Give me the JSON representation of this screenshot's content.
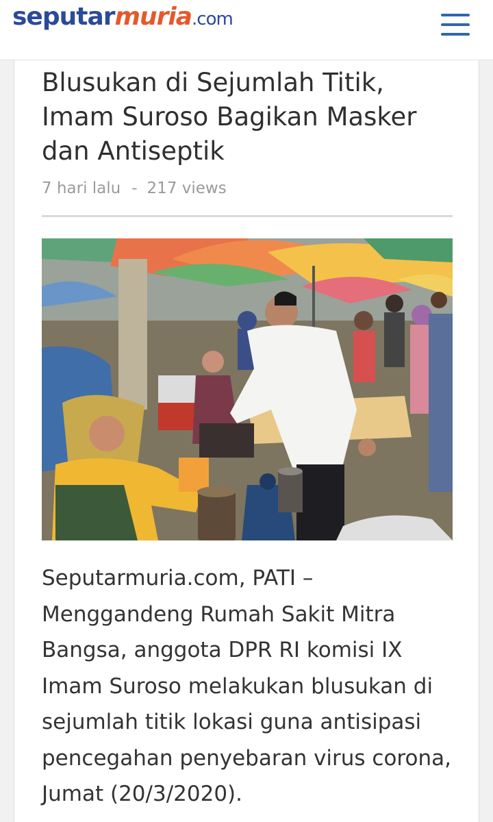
{
  "header": {
    "logo": {
      "part1": "seputar",
      "part2": "muria",
      "part3": ".com"
    },
    "menu_icon": "hamburger-menu-icon"
  },
  "article": {
    "title": "Blusukan di Sejumlah Titik, Imam Suroso Bagikan Masker dan Antiseptik",
    "time_ago": "7 hari lalu",
    "separator": "-",
    "views": "217 views",
    "body": "Seputarmuria.com, PATI – Menggandeng Rumah Sakit Mitra Bangsa, anggota DPR RI komisi IX Imam Suroso melakukan blusukan di sejumlah titik lokasi guna antisipasi pencegahan penyebaran virus corona, Jumat (20/3/2020)."
  },
  "colors": {
    "brand_blue": "#2a4a9a",
    "brand_orange": "#e4592c",
    "menu_blue": "#2f66b3"
  }
}
